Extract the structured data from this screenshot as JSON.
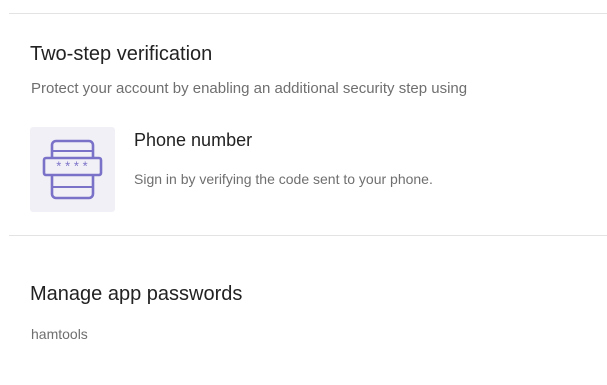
{
  "two_step": {
    "title": "Two-step verification",
    "description": "Protect your account by enabling an additional security step using",
    "methods": [
      {
        "icon": "phone-code-icon",
        "title": "Phone number",
        "description": "Sign in by verifying the code sent to your phone."
      }
    ]
  },
  "app_passwords": {
    "title": "Manage app passwords",
    "items": [
      "hamtools"
    ]
  },
  "colors": {
    "icon_accent": "#7a72c9",
    "icon_background": "#f1f0f6",
    "divider": "#e3e3e3",
    "muted_text": "#6f6f6f"
  }
}
